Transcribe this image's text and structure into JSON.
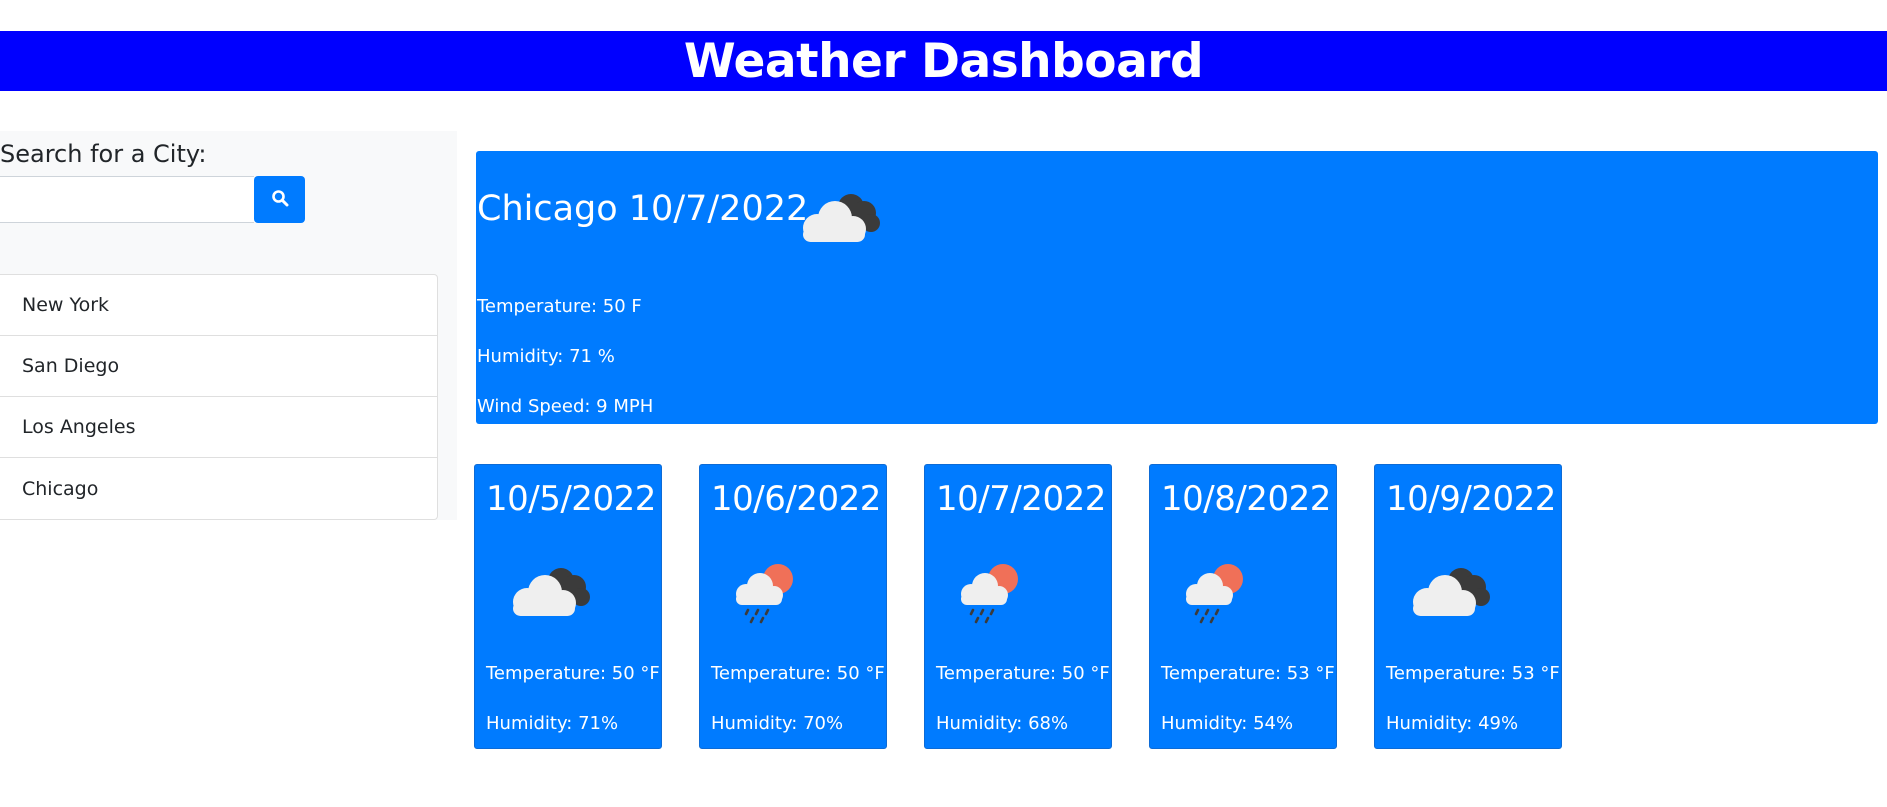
{
  "header": {
    "title": "Weather Dashboard"
  },
  "colors": {
    "header_bg": "#0000ff",
    "card_bg": "#007bff",
    "sidebar_bg": "#f8f9fa"
  },
  "sidebar": {
    "search_label": "Search for a City:",
    "search_value": "",
    "search_placeholder": "",
    "search_button_icon": "search-icon",
    "cities": [
      "New York",
      "San Diego",
      "Los Angeles",
      "Chicago"
    ]
  },
  "current": {
    "title": "Chicago 10/7/2022",
    "icon": "cloudy-icon",
    "temperature": "Temperature: 50 F",
    "humidity": "Humidity: 71 %",
    "wind": "Wind Speed: 9 MPH"
  },
  "forecast": [
    {
      "date": "10/5/2022",
      "icon": "cloudy-icon",
      "temp": "Temperature: 50 °F",
      "humidity": "Humidity: 71%"
    },
    {
      "date": "10/6/2022",
      "icon": "rain-sun-icon",
      "temp": "Temperature: 50 °F",
      "humidity": "Humidity: 70%"
    },
    {
      "date": "10/7/2022",
      "icon": "rain-sun-icon",
      "temp": "Temperature: 50 °F",
      "humidity": "Humidity: 68%"
    },
    {
      "date": "10/8/2022",
      "icon": "rain-sun-icon",
      "temp": "Temperature: 53 °F",
      "humidity": "Humidity: 54%"
    },
    {
      "date": "10/9/2022",
      "icon": "cloudy-icon",
      "temp": "Temperature: 53 °F",
      "humidity": "Humidity: 49%"
    }
  ]
}
